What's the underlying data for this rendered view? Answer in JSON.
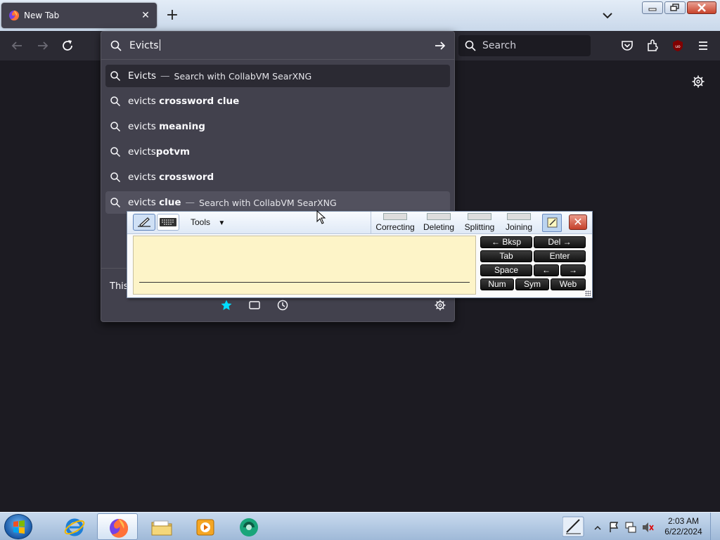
{
  "tab": {
    "title": "New Tab",
    "close_label": "✕"
  },
  "nav": {
    "search_placeholder": "Search"
  },
  "urlbar": {
    "value": "Evicts",
    "results": [
      {
        "plain": "Evicts",
        "bold": "",
        "action": "Search with CollabVM SearXNG",
        "state": "selected"
      },
      {
        "plain": "evicts ",
        "bold": "crossword clue",
        "action": "",
        "state": ""
      },
      {
        "plain": "evicts ",
        "bold": "meaning",
        "action": "",
        "state": ""
      },
      {
        "plain": "evicts",
        "bold": "potvm",
        "action": "",
        "state": ""
      },
      {
        "plain": "evicts ",
        "bold": "crossword",
        "action": "",
        "state": ""
      },
      {
        "plain": "evicts ",
        "bold": "clue",
        "action": "Search with CollabVM SearXNG",
        "state": "hover"
      }
    ],
    "footer_text": "This"
  },
  "tip": {
    "tools_label": "Tools",
    "gestures": [
      "Correcting",
      "Deleting",
      "Splitting",
      "Joining"
    ],
    "keys": {
      "bksp": "← Bksp",
      "del": "Del →",
      "tab": "Tab",
      "enter": "Enter",
      "space": "Space",
      "left": "←",
      "right": "→",
      "num": "Num",
      "sym": "Sym",
      "web": "Web"
    },
    "close_label": "✕"
  },
  "clock": {
    "time": "2:03 AM",
    "date": "6/22/2024"
  },
  "colors": {
    "accent": "#00ddff",
    "tab_bg": "#42414d",
    "toolbar_bg": "#2b2a33",
    "page_bg": "#1c1b22"
  }
}
